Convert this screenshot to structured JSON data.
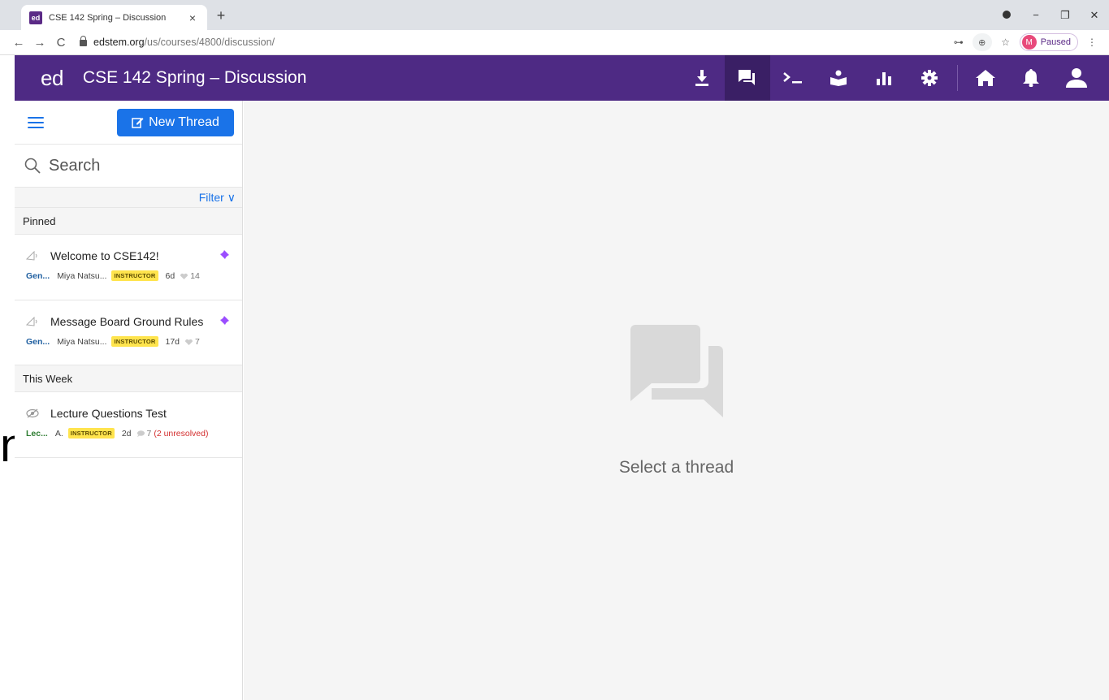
{
  "browser": {
    "tab_title": "CSE 142 Spring – Discussion",
    "favicon_text": "ed",
    "tab_close": "×",
    "new_tab": "+",
    "url_host": "edstem.org",
    "url_path": "/us/courses/4800/discussion/",
    "profile_initial": "M",
    "profile_status": "Paused"
  },
  "header": {
    "logo": "ed",
    "title": "CSE 142 Spring – Discussion",
    "bg_color": "#4e2a84"
  },
  "sidebar": {
    "new_thread_label": "New Thread",
    "search_placeholder": "Search",
    "filter_label": "Filter",
    "sections": [
      {
        "label": "Pinned",
        "threads": [
          {
            "title": "Welcome to CSE142!",
            "category": "Gen...",
            "author": "Miya Natsu...",
            "badge": "INSTRUCTOR",
            "time": "6d",
            "count": "14",
            "pinned": true
          },
          {
            "title": "Message Board Ground Rules",
            "category": "Gen...",
            "author": "Miya Natsu...",
            "badge": "INSTRUCTOR",
            "time": "17d",
            "count": "7",
            "pinned": true
          }
        ]
      },
      {
        "label": "This Week",
        "threads": [
          {
            "title": "Lecture Questions Test",
            "category": "Lec...",
            "author": "A.",
            "badge": "INSTRUCTOR",
            "time": "2d",
            "count": "7",
            "unresolved": "(2 unresolved)"
          }
        ]
      }
    ]
  },
  "main": {
    "empty_text": "Select a thread"
  },
  "colors": {
    "accent": "#1a73e8",
    "brand": "#4e2a84",
    "badge": "#ffe44d",
    "pin": "#9b4dff",
    "unresolved": "#d32f2f"
  }
}
